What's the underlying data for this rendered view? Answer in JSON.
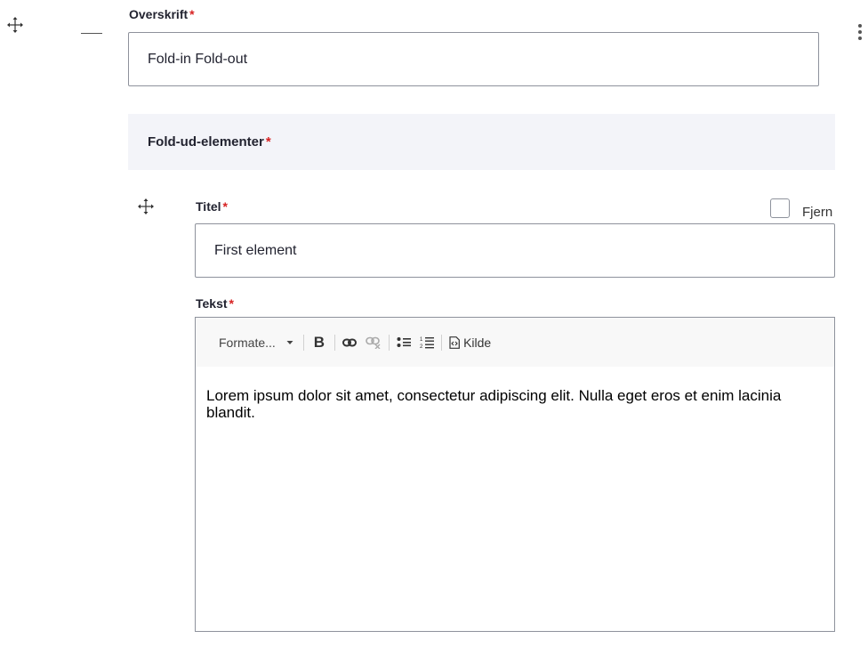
{
  "heading_field": {
    "label": "Overskrift",
    "required_mark": "*",
    "value": "Fold-in Fold-out"
  },
  "section": {
    "title": "Fold-ud-elementer",
    "required_mark": "*"
  },
  "item": {
    "title_label": "Titel",
    "title_required_mark": "*",
    "title_value": "First element",
    "remove_label": "Fjern",
    "text_label": "Tekst",
    "text_required_mark": "*"
  },
  "editor": {
    "format_label": "Formate...",
    "source_label": "Kilde",
    "body": "Lorem ipsum dolor sit amet, consectetur adipiscing elit. Nulla eget eros et enim lacinia blandit."
  },
  "icons": {
    "move": "move-icon",
    "collapse": "collapse-icon",
    "more": "more-vertical-icon",
    "bold": "bold-icon",
    "link": "link-icon",
    "unlink": "unlink-icon",
    "bullet_list": "bulleted-list-icon",
    "numbered_list": "numbered-list-icon",
    "source": "source-icon"
  }
}
